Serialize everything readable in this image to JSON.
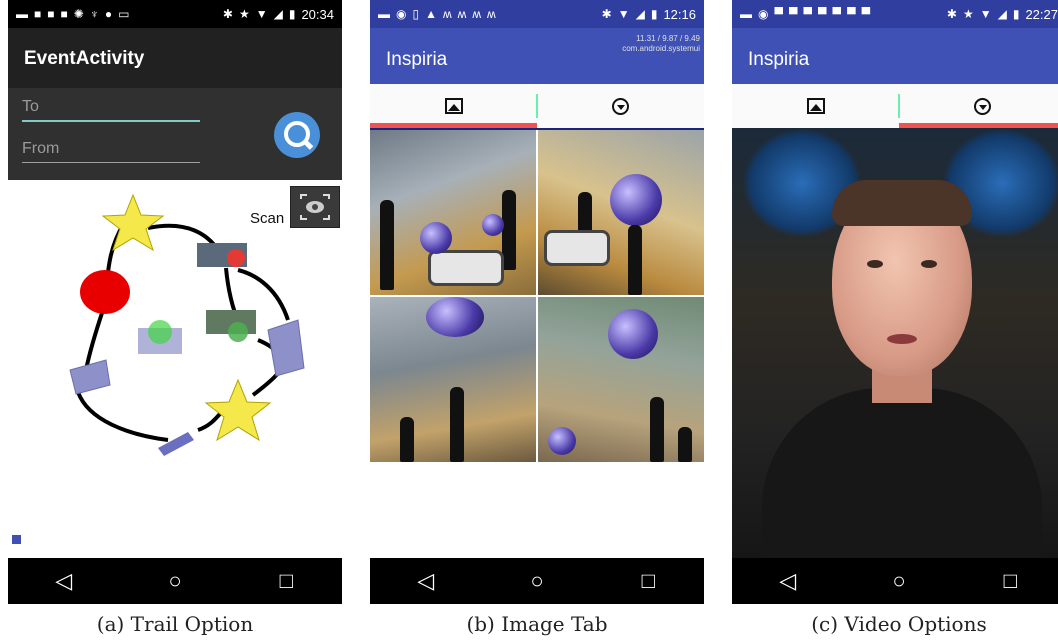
{
  "panels": {
    "trail": {
      "status_time": "20:34",
      "app_title": "EventActivity",
      "to_placeholder": "To",
      "from_placeholder": "From",
      "scan_label": "Scan",
      "caption": "(a) Trail Option"
    },
    "image": {
      "status_time": "12:16",
      "app_title": "Inspiria",
      "sys_line1": "11.31 / 9.87 / 9.49",
      "sys_line2": "com.android.systemui",
      "caption": "(b) Image Tab"
    },
    "video": {
      "status_time": "22:27",
      "app_title": "Inspiria",
      "caption": "(c) Video Options"
    }
  },
  "nav": {
    "back": "◁",
    "home": "○",
    "recents": "□"
  },
  "icons": {
    "search": "search-icon",
    "scan": "scan-icon",
    "image_tab": "image-icon",
    "video_tab": "play-circle-icon"
  },
  "colors": {
    "app_bar_indigo": "#3f51b5",
    "tab_underline": "#ef5350",
    "search_button": "#4a90d9"
  }
}
